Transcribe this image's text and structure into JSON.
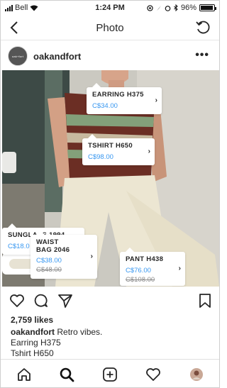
{
  "status_bar": {
    "carrier": "Bell",
    "time": "1:24 PM",
    "battery": "96%",
    "battery_level": 0.96
  },
  "nav": {
    "title": "Photo",
    "back_icon": "chevron-left-icon",
    "refresh_icon": "refresh-icon"
  },
  "post": {
    "username": "oakandfort",
    "avatar_text": "oak+fort",
    "more_icon": "more-horizontal-icon"
  },
  "product_tags": [
    {
      "name": "EARRING H375",
      "price": "C$34.00",
      "old_price": ""
    },
    {
      "name": "TSHIRT H650",
      "price": "C$98.00",
      "old_price": ""
    },
    {
      "name": "SUNGLASS 1994",
      "price": "C$18.0",
      "old_price": ""
    },
    {
      "name": "WAIST",
      "name2": "BAG 2046",
      "price": "C$38.00",
      "old_price": "C$48.00"
    },
    {
      "name": "PANT H438",
      "price": "C$76.00",
      "old_price": "C$108.00"
    }
  ],
  "actions": {
    "icons": [
      "heart-icon",
      "comment-icon",
      "share-icon",
      "bookmark-icon"
    ]
  },
  "likes": "2,759 likes",
  "caption": {
    "username": "oakandfort",
    "text": " Retro vibes.",
    "lines": [
      "Earring H375",
      "Tshirt H650"
    ]
  },
  "tab_bar": {
    "icons": [
      "home-icon",
      "search-icon",
      "add-post-icon",
      "activity-heart-icon",
      "profile-avatar-icon"
    ]
  },
  "colors": {
    "link_blue": "#3897f0",
    "text": "#262626",
    "muted": "#8e8e8e"
  }
}
